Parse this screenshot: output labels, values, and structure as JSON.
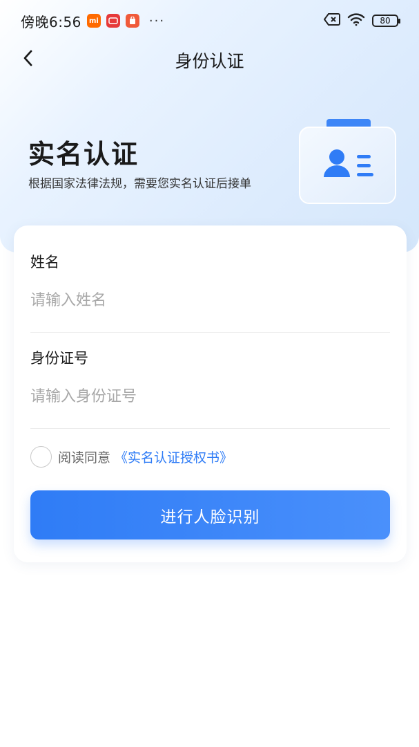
{
  "status_bar": {
    "time": "傍晚6:56",
    "dots": "···",
    "battery": "80",
    "icons": [
      "mi-app-icon",
      "news-app-icon",
      "shop-app-icon",
      "sim-error-icon",
      "wifi-icon",
      "battery-icon"
    ]
  },
  "nav": {
    "title": "身份认证",
    "back_icon": "chevron-left-icon"
  },
  "hero": {
    "title": "实名认证",
    "subtitle": "根据国家法律法规，需要您实名认证后接单",
    "illustration": "id-card-icon"
  },
  "form": {
    "name_label": "姓名",
    "name_placeholder": "请输入姓名",
    "name_value": "",
    "id_label": "身份证号",
    "id_placeholder": "请输入身份证号",
    "id_value": "",
    "agree_prefix": "阅读同意",
    "agree_link": "《实名认证授权书》",
    "agree_checked": false,
    "submit_label": "进行人脸识别"
  },
  "colors": {
    "accent": "#2f7cf6",
    "hero_bg": "#dcebfd",
    "placeholder": "#a8a8a8"
  }
}
